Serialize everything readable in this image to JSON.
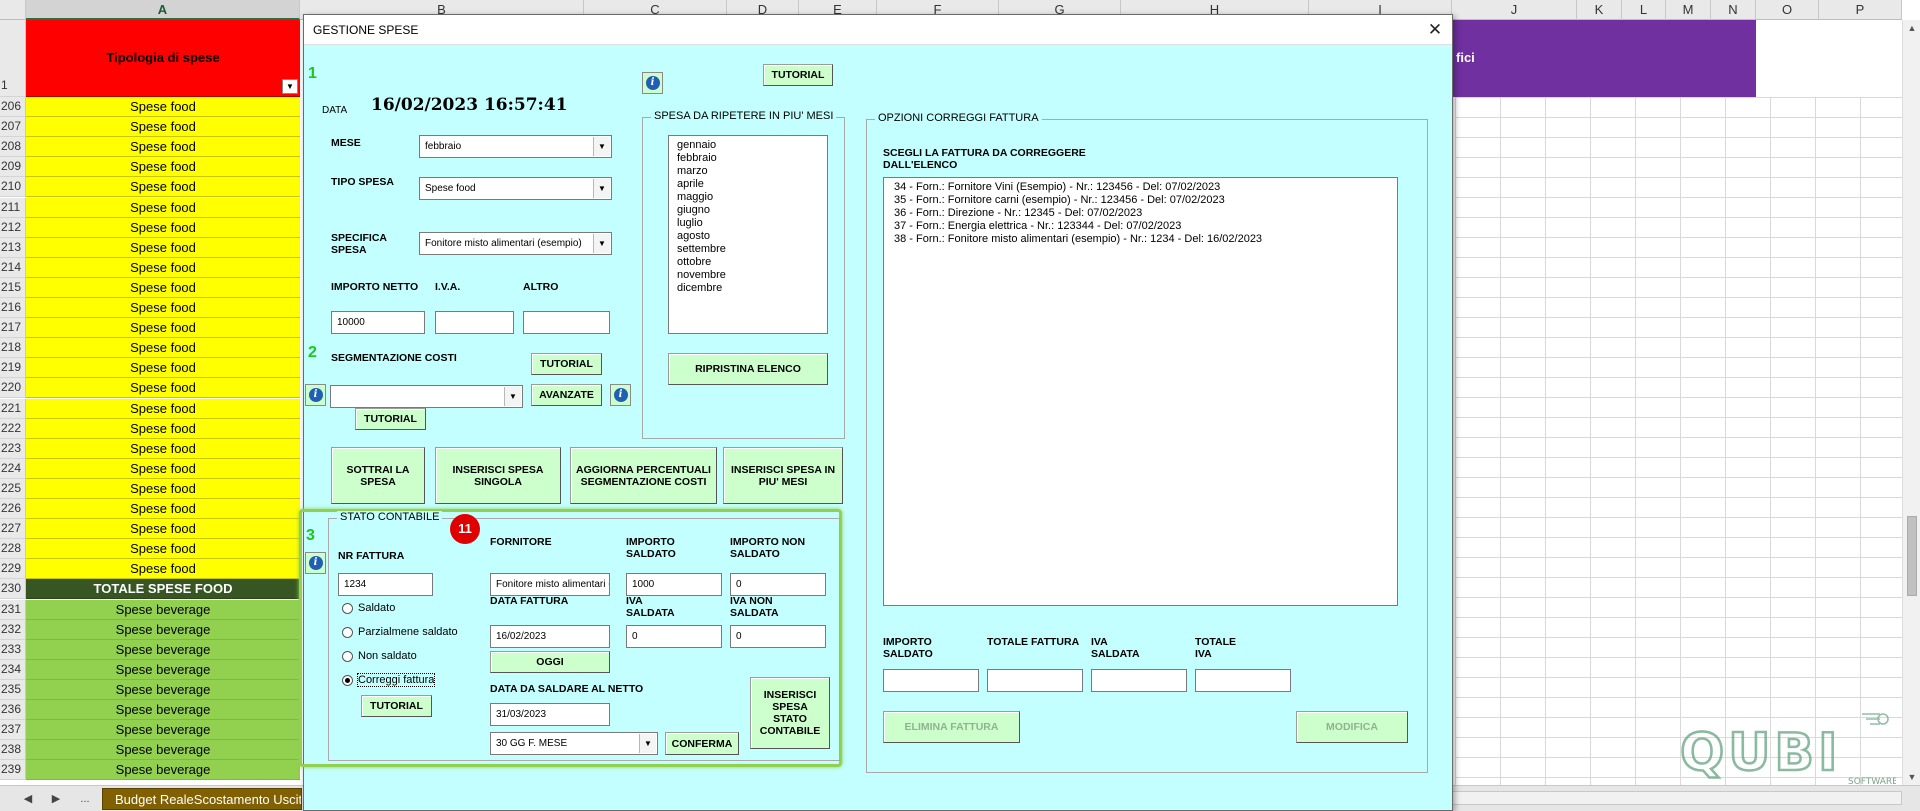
{
  "sheet": {
    "columns": [
      "A",
      "B",
      "C",
      "D",
      "E",
      "F",
      "G",
      "H",
      "I",
      "J",
      "K",
      "L",
      "M",
      "N",
      "O",
      "P"
    ],
    "header_row_number": "1",
    "header_cell": "Tipologia di spese",
    "purple_cell_fragment": "fici",
    "rows": [
      {
        "n": "206",
        "v": "Spese food",
        "t": "food"
      },
      {
        "n": "207",
        "v": "Spese food",
        "t": "food"
      },
      {
        "n": "208",
        "v": "Spese food",
        "t": "food"
      },
      {
        "n": "209",
        "v": "Spese food",
        "t": "food"
      },
      {
        "n": "210",
        "v": "Spese food",
        "t": "food"
      },
      {
        "n": "211",
        "v": "Spese food",
        "t": "food"
      },
      {
        "n": "212",
        "v": "Spese food",
        "t": "food"
      },
      {
        "n": "213",
        "v": "Spese food",
        "t": "food"
      },
      {
        "n": "214",
        "v": "Spese food",
        "t": "food"
      },
      {
        "n": "215",
        "v": "Spese food",
        "t": "food"
      },
      {
        "n": "216",
        "v": "Spese food",
        "t": "food"
      },
      {
        "n": "217",
        "v": "Spese food",
        "t": "food"
      },
      {
        "n": "218",
        "v": "Spese food",
        "t": "food"
      },
      {
        "n": "219",
        "v": "Spese food",
        "t": "food"
      },
      {
        "n": "220",
        "v": "Spese food",
        "t": "food"
      },
      {
        "n": "221",
        "v": "Spese food",
        "t": "food"
      },
      {
        "n": "222",
        "v": "Spese food",
        "t": "food"
      },
      {
        "n": "223",
        "v": "Spese food",
        "t": "food"
      },
      {
        "n": "224",
        "v": "Spese food",
        "t": "food"
      },
      {
        "n": "225",
        "v": "Spese food",
        "t": "food"
      },
      {
        "n": "226",
        "v": "Spese food",
        "t": "food"
      },
      {
        "n": "227",
        "v": "Spese food",
        "t": "food"
      },
      {
        "n": "228",
        "v": "Spese food",
        "t": "food"
      },
      {
        "n": "229",
        "v": "Spese food",
        "t": "food"
      },
      {
        "n": "230",
        "v": "TOTALE SPESE FOOD",
        "t": "total"
      },
      {
        "n": "231",
        "v": "Spese beverage",
        "t": "bev"
      },
      {
        "n": "232",
        "v": "Spese beverage",
        "t": "bev"
      },
      {
        "n": "233",
        "v": "Spese beverage",
        "t": "bev"
      },
      {
        "n": "234",
        "v": "Spese beverage",
        "t": "bev"
      },
      {
        "n": "235",
        "v": "Spese beverage",
        "t": "bev"
      },
      {
        "n": "236",
        "v": "Spese beverage",
        "t": "bev"
      },
      {
        "n": "237",
        "v": "Spese beverage",
        "t": "bev"
      },
      {
        "n": "238",
        "v": "Spese beverage",
        "t": "bev"
      },
      {
        "n": "239",
        "v": "Spese beverage",
        "t": "bev"
      }
    ],
    "tab_ellipsis": "...",
    "sheet_tab": "Budget RealeScostamento Uscite",
    "logo_text": "QUBI",
    "logo_sub": "SOFTWARE"
  },
  "dialog": {
    "title": "GESTIONE SPESE",
    "close": "✕",
    "steps": {
      "s1": "1",
      "s2": "2",
      "s3": "3"
    },
    "info_glyph": "i",
    "data_label": "DATA",
    "data_value": "16/02/2023 16:57:41",
    "tutorial_label": "TUTORIAL",
    "mese_label": "MESE",
    "mese_value": "febbraio",
    "tipo_label": "TIPO SPESA",
    "tipo_value": "Spese food",
    "specifica_label": "SPECIFICA SPESA",
    "specifica_value": "Fonitore misto alimentari (esempio)",
    "importo_netto_label": "IMPORTO NETTO",
    "iva_label": "I.V.A.",
    "altro_label": "ALTRO",
    "importo_netto_value": "10000",
    "iva_value": "",
    "altro_value": "",
    "segmentazione_label": "SEGMENTAZIONE COSTI",
    "segmentazione_value": "",
    "avanzate_label": "AVANZATE",
    "ripetere_frame": "SPESA DA RIPETERE IN PIU' MESI",
    "months": [
      "gennaio",
      "febbraio",
      "marzo",
      "aprile",
      "maggio",
      "giugno",
      "luglio",
      "agosto",
      "settembre",
      "ottobre",
      "novembre",
      "dicembre"
    ],
    "ripristina_label": "RIPRISTINA ELENCO",
    "actions": {
      "sottrai": "SOTTRAI LA SPESA",
      "inserisci_singola": "INSERISCI SPESA SINGOLA",
      "aggiorna": "AGGIORNA PERCENTUALI SEGMENTAZIONE COSTI",
      "inserisci_piu_mesi": "INSERISCI SPESA IN PIU' MESI"
    },
    "correggi_frame": "OPZIONI CORREGGI FATTURA",
    "scegli_label": "SCEGLI LA FATTURA DA CORREGGERE DALL'ELENCO",
    "invoices": [
      "34 - Forn.: Fornitore Vini (Esempio) - Nr.: 123456 - Del: 07/02/2023",
      "35 - Forn.: Fornitore carni (esempio) - Nr.: 123456 - Del: 07/02/2023",
      "36 - Forn.: Direzione - Nr.: 12345 - Del: 07/02/2023",
      "37 - Forn.: Energia elettrica - Nr.: 123344 - Del: 07/02/2023",
      "38 - Forn.: Fonitore misto alimentari (esempio) - Nr.: 1234 - Del: 16/02/2023"
    ],
    "importo_saldato_label": "IMPORTO SALDATO",
    "totale_fattura_label": "TOTALE FATTURA",
    "iva_saldata_label": "IVA SALDATA",
    "totale_iva_label": "TOTALE IVA",
    "elimina_label": "ELIMINA FATTURA",
    "modifica_label": "MODIFICA",
    "stato": {
      "frame": "STATO CONTABILE",
      "badge": "11",
      "nr_fattura_label": "NR FATTURA",
      "nr_fattura_value": "1234",
      "radios": [
        "Saldato",
        "Parzialmene saldato",
        "Non saldato",
        "Correggi fattura"
      ],
      "tutorial_label": "TUTORIAL",
      "fornitore_label": "FORNITORE",
      "fornitore_value": "Fonitore misto alimentari (esempio)",
      "importo_saldato_label": "IMPORTO SALDATO",
      "importo_saldato_value": "1000",
      "importo_non_saldato_label": "IMPORTO NON SALDATO",
      "importo_non_saldato_value": "0",
      "data_fattura_label": "DATA FATTURA",
      "data_fattura_value": "16/02/2023",
      "iva_saldata_label": "IVA SALDATA",
      "iva_saldata_value": "0",
      "iva_non_saldata_label": "IVA NON SALDATA",
      "iva_non_saldata_value": "0",
      "oggi_label": "OGGI",
      "data_da_saldare_label": "DATA DA SALDARE AL NETTO",
      "data_da_saldare_value": "31/03/2023",
      "termini_value": "30 GG F. MESE",
      "conferma_label": "CONFERMA",
      "inserisci_stato_label": "INSERISCI SPESA STATO CONTABILE"
    }
  },
  "colors": {
    "dialog_bg": "#c4ffff",
    "button_bg": "#ccffcc",
    "food": "#ffff00",
    "beverage": "#92d050",
    "total": "#375623",
    "header_red": "#ff0000",
    "purple": "#7030a0",
    "step_green": "#19c819",
    "badge_red": "#e00000"
  }
}
